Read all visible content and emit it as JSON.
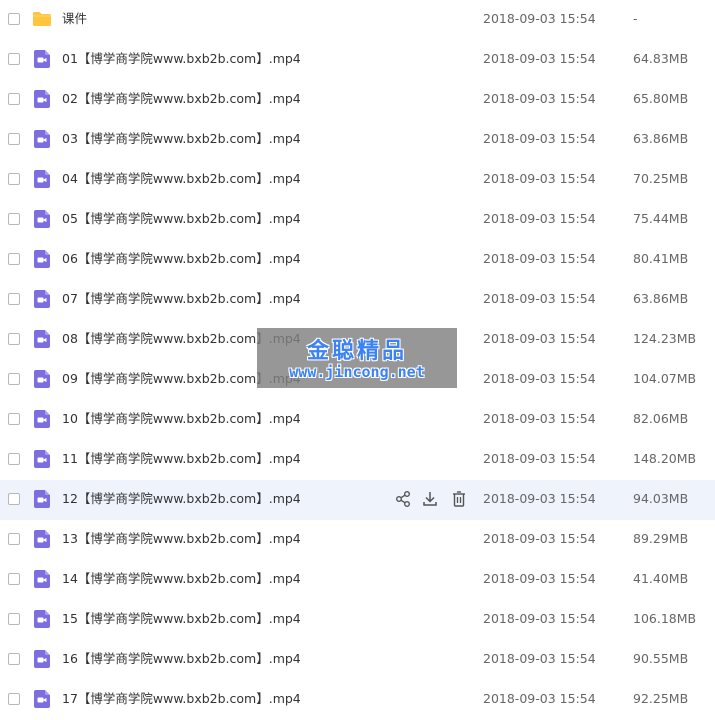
{
  "colors": {
    "video_icon": "#7a6ee0",
    "folder_icon": "#ffc53d",
    "hover_row": "#eef3fc",
    "action_icon": "#555555",
    "watermark_text": "#3b82f6"
  },
  "rows": [
    {
      "type": "folder",
      "icon": "folder-icon",
      "name": "课件",
      "date": "2018-09-03 15:54",
      "size": "-"
    },
    {
      "type": "video",
      "icon": "video-file-icon",
      "name": "01【博学商学院www.bxb2b.com】.mp4",
      "date": "2018-09-03 15:54",
      "size": "64.83MB"
    },
    {
      "type": "video",
      "icon": "video-file-icon",
      "name": "02【博学商学院www.bxb2b.com】.mp4",
      "date": "2018-09-03 15:54",
      "size": "65.80MB"
    },
    {
      "type": "video",
      "icon": "video-file-icon",
      "name": "03【博学商学院www.bxb2b.com】.mp4",
      "date": "2018-09-03 15:54",
      "size": "63.86MB"
    },
    {
      "type": "video",
      "icon": "video-file-icon",
      "name": "04【博学商学院www.bxb2b.com】.mp4",
      "date": "2018-09-03 15:54",
      "size": "70.25MB"
    },
    {
      "type": "video",
      "icon": "video-file-icon",
      "name": "05【博学商学院www.bxb2b.com】.mp4",
      "date": "2018-09-03 15:54",
      "size": "75.44MB"
    },
    {
      "type": "video",
      "icon": "video-file-icon",
      "name": "06【博学商学院www.bxb2b.com】.mp4",
      "date": "2018-09-03 15:54",
      "size": "80.41MB"
    },
    {
      "type": "video",
      "icon": "video-file-icon",
      "name": "07【博学商学院www.bxb2b.com】.mp4",
      "date": "2018-09-03 15:54",
      "size": "63.86MB"
    },
    {
      "type": "video",
      "icon": "video-file-icon",
      "name": "08【博学商学院www.bxb2b.com】.mp4",
      "date": "2018-09-03 15:54",
      "size": "124.23MB"
    },
    {
      "type": "video",
      "icon": "video-file-icon",
      "name": "09【博学商学院www.bxb2b.com】.mp4",
      "date": "2018-09-03 15:54",
      "size": "104.07MB"
    },
    {
      "type": "video",
      "icon": "video-file-icon",
      "name": "10【博学商学院www.bxb2b.com】.mp4",
      "date": "2018-09-03 15:54",
      "size": "82.06MB"
    },
    {
      "type": "video",
      "icon": "video-file-icon",
      "name": "11【博学商学院www.bxb2b.com】.mp4",
      "date": "2018-09-03 15:54",
      "size": "148.20MB"
    },
    {
      "type": "video",
      "icon": "video-file-icon",
      "name": "12【博学商学院www.bxb2b.com】.mp4",
      "date": "2018-09-03 15:54",
      "size": "94.03MB",
      "hovered": true
    },
    {
      "type": "video",
      "icon": "video-file-icon",
      "name": "13【博学商学院www.bxb2b.com】.mp4",
      "date": "2018-09-03 15:54",
      "size": "89.29MB"
    },
    {
      "type": "video",
      "icon": "video-file-icon",
      "name": "14【博学商学院www.bxb2b.com】.mp4",
      "date": "2018-09-03 15:54",
      "size": "41.40MB"
    },
    {
      "type": "video",
      "icon": "video-file-icon",
      "name": "15【博学商学院www.bxb2b.com】.mp4",
      "date": "2018-09-03 15:54",
      "size": "106.18MB"
    },
    {
      "type": "video",
      "icon": "video-file-icon",
      "name": "16【博学商学院www.bxb2b.com】.mp4",
      "date": "2018-09-03 15:54",
      "size": "90.55MB"
    },
    {
      "type": "video",
      "icon": "video-file-icon",
      "name": "17【博学商学院www.bxb2b.com】.mp4",
      "date": "2018-09-03 15:54",
      "size": "92.25MB"
    }
  ],
  "row_actions": [
    {
      "icon": "share-icon"
    },
    {
      "icon": "download-icon"
    },
    {
      "icon": "delete-icon"
    }
  ],
  "watermark": {
    "title": "金聪精品",
    "url": "www.jincong.net"
  }
}
